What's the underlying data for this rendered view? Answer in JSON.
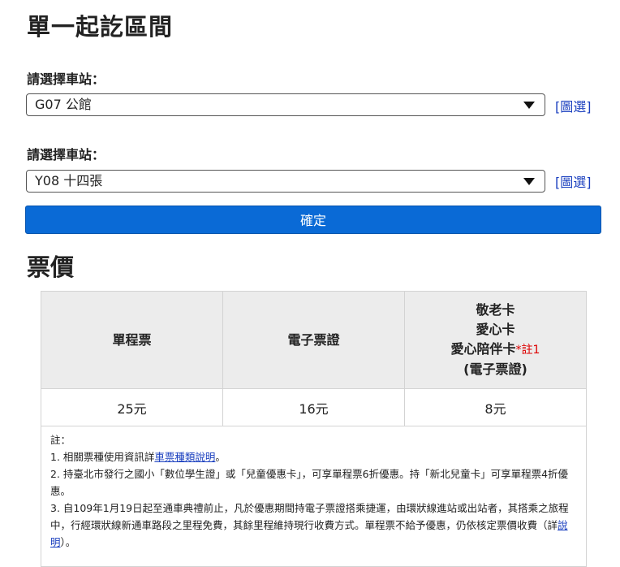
{
  "page": {
    "title": "單一起訖區間"
  },
  "form": {
    "origin_label": "請選擇車站：",
    "origin_value": "G07 公館",
    "origin_map_link": "[圖選]",
    "dest_label": "請選擇車站：",
    "dest_value": "Y08 十四張",
    "dest_map_link": "[圖選]",
    "confirm_label": "確定"
  },
  "fares": {
    "title": "票價",
    "headers": {
      "single": "單程票",
      "ecard": "電子票證",
      "senior_line1": "敬老卡",
      "senior_line2": "愛心卡",
      "senior_line3": "愛心陪伴卡",
      "senior_note_ref": "*註1",
      "senior_line4": "(電子票證)"
    },
    "values": {
      "single": "25元",
      "ecard": "16元",
      "senior": "8元"
    }
  },
  "notes": {
    "heading": "註：",
    "n1_prefix": "1. 相關票種使用資訊詳",
    "n1_link": "車票種類說明",
    "n1_suffix": "。",
    "n2": "2. 持臺北市發行之國小「數位學生證」或「兒童優惠卡」，可享單程票6折優惠。持「新北兒童卡」可享單程票4折優惠。",
    "n3_prefix": "3. 自109年1月19日起至通車典禮前止，凡於優惠期間持電子票證搭乘捷運，由環狀線進站或出站者，其搭乘之旅程中，行經環狀線新通車路段之里程免費，其餘里程維持現行收費方式。單程票不給予優惠，仍依核定票價收費（詳",
    "n3_link": "說明",
    "n3_suffix": "）。"
  },
  "colors": {
    "accent": "#0a6ad6",
    "link": "#1a3fbf",
    "note_ref": "#dd0000",
    "header_bg": "#ececec"
  }
}
